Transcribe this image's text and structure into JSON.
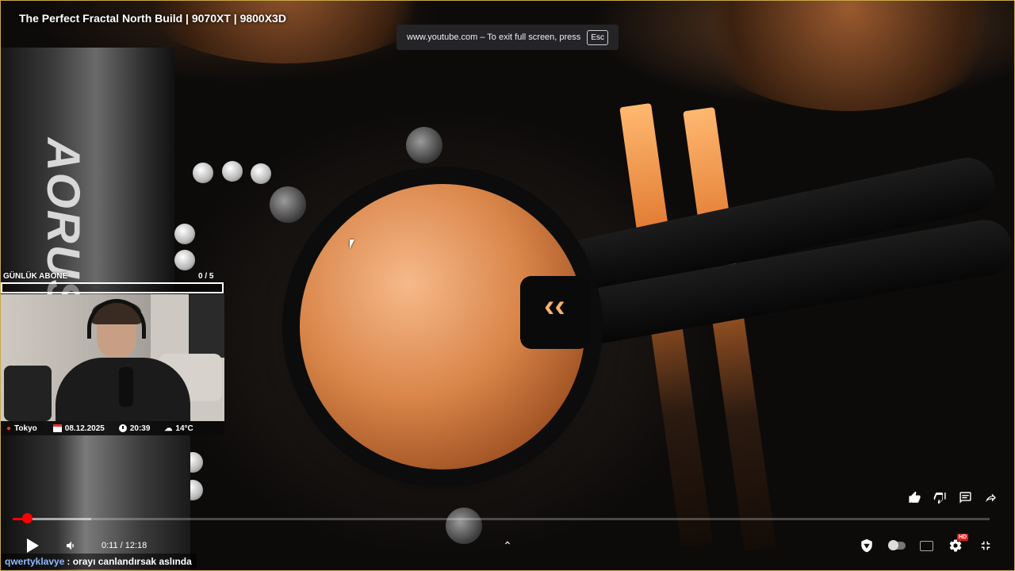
{
  "player": {
    "title": "The Perfect Fractal North Build | 9070XT | 9800X3D",
    "fullscreen_notice": {
      "text": "www.youtube.com – To exit full screen, press",
      "key": "Esc"
    },
    "time_display": "0:11 / 12:18",
    "progress_fraction": 0.0149,
    "buffer_fraction": 0.08,
    "colors": {
      "progress": "#ff0000",
      "hd_badge": "#e02020",
      "chat_user": "#8fb9ff"
    },
    "hd_badge": "HD"
  },
  "overlay": {
    "goal": {
      "label": "GÜNLÜK ABONE",
      "count": "0  / 5",
      "fraction": 0
    },
    "webcam_info": {
      "location": "Tokyo",
      "date": "08.12.2025",
      "time": "20:39",
      "temperature": "14°C"
    },
    "chat": {
      "user": "qwertyklavye",
      "message": ": orayı canlandırsak aslında"
    }
  },
  "scene": {
    "brand_text": "AORUS"
  },
  "icons": {
    "like": "thumb-up-icon",
    "dislike": "thumb-down-icon",
    "comments": "comment-icon",
    "share": "share-icon",
    "play": "play-icon",
    "volume": "volume-icon",
    "chevron": "chevron-up-icon",
    "shield": "shield-icon",
    "autoplay": "autoplay-toggle",
    "captions": "captions-icon",
    "settings": "gear-icon",
    "exit_fullscreen": "exit-fullscreen-icon"
  }
}
